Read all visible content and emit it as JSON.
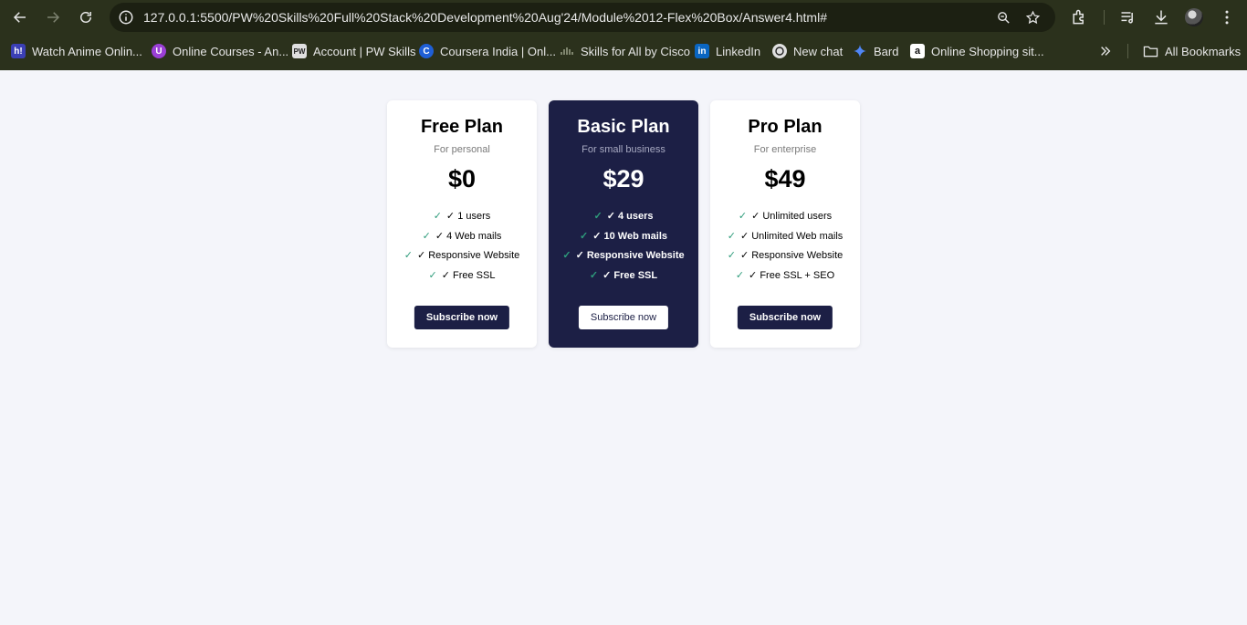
{
  "browser": {
    "url": "127.0.0.1:5500/PW%20Skills%20Full%20Stack%20Development%20Aug'24/Module%2012-Flex%20Box/Answer4.html#",
    "bookmarks": [
      {
        "label": "Watch Anime Onlin...",
        "icon": "h!",
        "color": "#3b3fb5"
      },
      {
        "label": "Online Courses - An...",
        "icon": "U",
        "color": "#9b3fd6"
      },
      {
        "label": "Account | PW Skills",
        "icon": "PW",
        "color": "#e0e0e0"
      },
      {
        "label": "Coursera India | Onl...",
        "icon": "C",
        "color": "#1f5fd6"
      },
      {
        "label": "Skills for All by Cisco",
        "icon": "cisco",
        "color": "#2b311c"
      },
      {
        "label": "LinkedIn",
        "icon": "in",
        "color": "#0a66c2"
      },
      {
        "label": "New chat",
        "icon": "chatgpt",
        "color": "#e0e0e0"
      },
      {
        "label": "Bard",
        "icon": "bard",
        "color": "#4f86f7"
      },
      {
        "label": "Online Shopping sit...",
        "icon": "a",
        "color": "#ffffff"
      }
    ],
    "all_bookmarks_label": "All Bookmarks"
  },
  "plans": [
    {
      "name": "Free Plan",
      "subtitle": "For personal",
      "price": "$0",
      "features": [
        "✓ 1 users",
        "✓ 4 Web mails",
        "✓ Responsive Website",
        "✓ Free SSL"
      ],
      "button": "Subscribe now"
    },
    {
      "name": "Basic Plan",
      "subtitle": "For small business",
      "price": "$29",
      "features": [
        "✓ 4 users",
        "✓ 10 Web mails",
        "✓ Responsive Website",
        "✓ Free SSL"
      ],
      "button": "Subscribe now"
    },
    {
      "name": "Pro Plan",
      "subtitle": "For enterprise",
      "price": "$49",
      "features": [
        "✓ Unlimited users",
        "✓ Unlimited Web mails",
        "✓ Responsive Website",
        "✓ Free SSL + SEO"
      ],
      "button": "Subscribe now"
    }
  ],
  "tick": "✓",
  "colors": {
    "accent": "#1c1f45",
    "tick": "#2e9c7b",
    "page_bg": "#f4f5fa",
    "chrome_bg": "#2b311c"
  }
}
